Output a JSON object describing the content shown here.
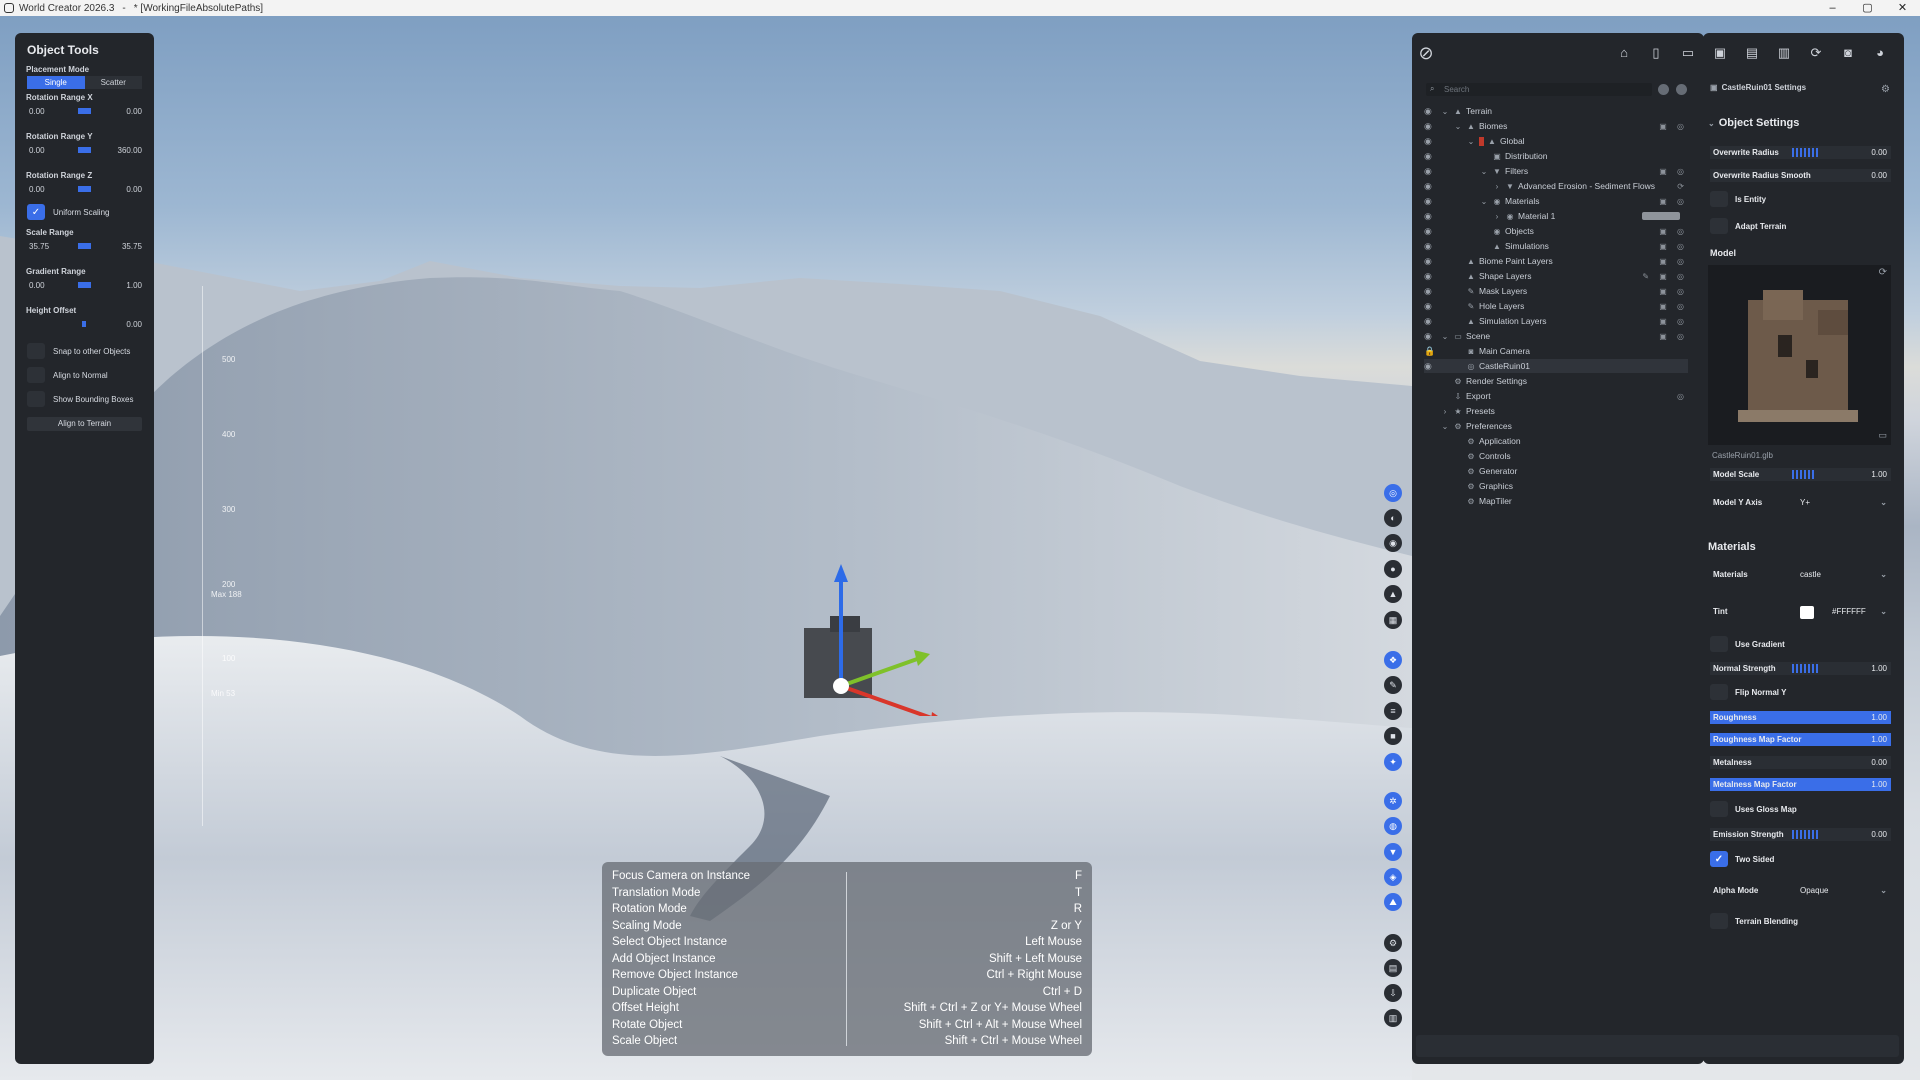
{
  "titlebar": {
    "app": "World Creator 2026.3",
    "sep": "-",
    "file": "* [WorkingFileAbsolutePaths]",
    "min": "–",
    "max": "▢",
    "close": "✕"
  },
  "object_tools": {
    "title": "Object Tools",
    "placement_label": "Placement Mode",
    "mode_single": "Single",
    "mode_scatter": "Scatter",
    "rot_x_label": "Rotation Range X",
    "rot_x_min": "0.00",
    "rot_x_max": "0.00",
    "rot_y_label": "Rotation Range Y",
    "rot_y_min": "0.00",
    "rot_y_max": "360.00",
    "rot_z_label": "Rotation Range Z",
    "rot_z_min": "0.00",
    "rot_z_max": "0.00",
    "uniform_scaling": "Uniform Scaling",
    "scale_label": "Scale Range",
    "scale_min": "35.75",
    "scale_max": "35.75",
    "gradient_label": "Gradient Range",
    "grad_min": "0.00",
    "grad_max": "1.00",
    "height_label": "Height Offset",
    "height_val": "0.00",
    "snap": "Snap to other Objects",
    "align_normal": "Align to Normal",
    "bounding": "Show Bounding Boxes",
    "align_terrain": "Align to Terrain"
  },
  "axis": {
    "t500": "500",
    "t400": "400",
    "t300": "300",
    "t200": "200",
    "max": "Max 188",
    "t100": "100",
    "min": "Min 53"
  },
  "tree": {
    "search_placeholder": "Search",
    "items": [
      {
        "label": "Terrain"
      },
      {
        "label": "Biomes"
      },
      {
        "label": "Global"
      },
      {
        "label": "Distribution"
      },
      {
        "label": "Filters"
      },
      {
        "label": "Advanced Erosion - Sediment Flows"
      },
      {
        "label": "Materials"
      },
      {
        "label": "Material 1"
      },
      {
        "label": "Objects"
      },
      {
        "label": "Simulations"
      },
      {
        "label": "Biome Paint Layers"
      },
      {
        "label": "Shape Layers"
      },
      {
        "label": "Mask Layers"
      },
      {
        "label": "Hole Layers"
      },
      {
        "label": "Simulation Layers"
      },
      {
        "label": "Scene"
      },
      {
        "label": "Main Camera"
      },
      {
        "label": "CastleRuin01"
      },
      {
        "label": "Render Settings"
      },
      {
        "label": "Export"
      },
      {
        "label": "Presets"
      },
      {
        "label": "Preferences"
      },
      {
        "label": "Application"
      },
      {
        "label": "Controls"
      },
      {
        "label": "Generator"
      },
      {
        "label": "Graphics"
      },
      {
        "label": "MapTiler"
      }
    ]
  },
  "props": {
    "header": "CastleRuin01 Settings",
    "section": "Object Settings",
    "overwrite_radius": "Overwrite Radius",
    "overwrite_radius_v": "0.00",
    "overwrite_smooth": "Overwrite Radius Smooth",
    "overwrite_smooth_v": "0.00",
    "is_entity": "Is Entity",
    "adapt_terrain": "Adapt Terrain",
    "model": "Model",
    "model_file": "CastleRuin01.glb",
    "model_scale": "Model Scale",
    "model_scale_v": "1.00",
    "model_y_axis": "Model Y Axis",
    "model_y_axis_v": "Y+",
    "materials_section": "Materials",
    "materials": "Materials",
    "materials_v": "castle",
    "tint": "Tint",
    "tint_v": "#FFFFFF",
    "use_gradient": "Use Gradient",
    "normal_strength": "Normal Strength",
    "normal_strength_v": "1.00",
    "flip_normal": "Flip Normal Y",
    "roughness": "Roughness",
    "roughness_v": "1.00",
    "roughness_map": "Roughness Map Factor",
    "roughness_map_v": "1.00",
    "metalness": "Metalness",
    "metalness_v": "0.00",
    "metalness_map": "Metalness Map Factor",
    "metalness_map_v": "1.00",
    "gloss": "Uses Gloss Map",
    "emission": "Emission Strength",
    "emission_v": "0.00",
    "two_sided": "Two Sided",
    "alpha_mode": "Alpha Mode",
    "alpha_mode_v": "Opaque",
    "terrain_blending": "Terrain Blending"
  },
  "shortcuts": [
    {
      "action": "Focus Camera on Instance",
      "key": "F"
    },
    {
      "action": "Translation Mode",
      "key": "T"
    },
    {
      "action": "Rotation Mode",
      "key": "R"
    },
    {
      "action": "Scaling Mode",
      "key": "Z or Y"
    },
    {
      "action": "Select Object Instance",
      "key": "Left Mouse"
    },
    {
      "action": "Add Object Instance",
      "key": "Shift + Left Mouse"
    },
    {
      "action": "Remove Object Instance",
      "key": "Ctrl + Right Mouse"
    },
    {
      "action": "Duplicate Object",
      "key": "Ctrl + D"
    },
    {
      "action": "Offset Height",
      "key": "Shift + Ctrl + Z or Y+ Mouse Wheel"
    },
    {
      "action": "Rotate Object",
      "key": "Shift + Ctrl + Alt + Mouse Wheel"
    },
    {
      "action": "Scale Object",
      "key": "Shift + Ctrl + Mouse Wheel"
    }
  ],
  "colors": {
    "accent": "#3a6ee8",
    "panel": "#23262b"
  }
}
